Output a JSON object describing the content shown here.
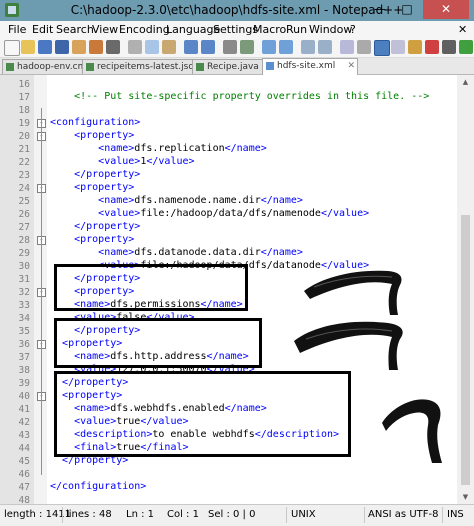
{
  "window": {
    "title": "C:\\hadoop-2.3.0\\etc\\hadoop\\hdfs-site.xml - Notepad++"
  },
  "menu": [
    "File",
    "Edit",
    "Search",
    "View",
    "Encoding",
    "Language",
    "Settings",
    "Macro",
    "Run",
    "Window",
    "?"
  ],
  "tabs": [
    {
      "label": "hadoop-env.cmd"
    },
    {
      "label": "recipeitems-latest.json"
    },
    {
      "label": "Recipe.java"
    },
    {
      "label": "hdfs-site.xml"
    }
  ],
  "lines": [
    {
      "num": "16",
      "parts": []
    },
    {
      "num": "17",
      "parts": [
        {
          "t": "    ",
          "c": "c-text"
        },
        {
          "t": "<!-- Put site-specific property overrides in this file. -->",
          "c": "c-comment"
        }
      ]
    },
    {
      "num": "18",
      "parts": []
    },
    {
      "num": "19",
      "parts": [
        {
          "t": "<configuration>",
          "c": "c-tag"
        }
      ]
    },
    {
      "num": "20",
      "parts": [
        {
          "t": "    ",
          "c": "c-text"
        },
        {
          "t": "<property>",
          "c": "c-tag"
        }
      ]
    },
    {
      "num": "21",
      "parts": [
        {
          "t": "        ",
          "c": "c-text"
        },
        {
          "t": "<name>",
          "c": "c-tag"
        },
        {
          "t": "dfs.replication",
          "c": "c-text"
        },
        {
          "t": "</name>",
          "c": "c-tag"
        }
      ]
    },
    {
      "num": "22",
      "parts": [
        {
          "t": "        ",
          "c": "c-text"
        },
        {
          "t": "<value>",
          "c": "c-tag"
        },
        {
          "t": "1",
          "c": "c-text"
        },
        {
          "t": "</value>",
          "c": "c-tag"
        }
      ]
    },
    {
      "num": "23",
      "parts": [
        {
          "t": "    ",
          "c": "c-text"
        },
        {
          "t": "</property>",
          "c": "c-tag"
        }
      ]
    },
    {
      "num": "24",
      "parts": [
        {
          "t": "    ",
          "c": "c-text"
        },
        {
          "t": "<property>",
          "c": "c-tag"
        }
      ]
    },
    {
      "num": "25",
      "parts": [
        {
          "t": "        ",
          "c": "c-text"
        },
        {
          "t": "<name>",
          "c": "c-tag"
        },
        {
          "t": "dfs.namenode.name.dir",
          "c": "c-text"
        },
        {
          "t": "</name>",
          "c": "c-tag"
        }
      ]
    },
    {
      "num": "26",
      "parts": [
        {
          "t": "        ",
          "c": "c-text"
        },
        {
          "t": "<value>",
          "c": "c-tag"
        },
        {
          "t": "file:/hadoop/data/dfs/namenode",
          "c": "c-text"
        },
        {
          "t": "</value>",
          "c": "c-tag"
        }
      ]
    },
    {
      "num": "27",
      "parts": [
        {
          "t": "    ",
          "c": "c-text"
        },
        {
          "t": "</property>",
          "c": "c-tag"
        }
      ]
    },
    {
      "num": "28",
      "parts": [
        {
          "t": "    ",
          "c": "c-text"
        },
        {
          "t": "<property>",
          "c": "c-tag"
        }
      ]
    },
    {
      "num": "29",
      "parts": [
        {
          "t": "        ",
          "c": "c-text"
        },
        {
          "t": "<name>",
          "c": "c-tag"
        },
        {
          "t": "dfs.datanode.data.dir",
          "c": "c-text"
        },
        {
          "t": "</name>",
          "c": "c-tag"
        }
      ]
    },
    {
      "num": "30",
      "parts": [
        {
          "t": "        ",
          "c": "c-text"
        },
        {
          "t": "<value>",
          "c": "c-tag"
        },
        {
          "t": "file:/hadoop/data/dfs/datanode",
          "c": "c-text"
        },
        {
          "t": "</value>",
          "c": "c-tag"
        }
      ]
    },
    {
      "num": "31",
      "parts": [
        {
          "t": "    ",
          "c": "c-text"
        },
        {
          "t": "</property>",
          "c": "c-tag"
        }
      ]
    },
    {
      "num": "32",
      "parts": [
        {
          "t": "    ",
          "c": "c-text"
        },
        {
          "t": "<property>",
          "c": "c-tag"
        }
      ]
    },
    {
      "num": "33",
      "parts": [
        {
          "t": "    ",
          "c": "c-text"
        },
        {
          "t": "<name>",
          "c": "c-tag"
        },
        {
          "t": "dfs.permissions",
          "c": "c-text"
        },
        {
          "t": "</name>",
          "c": "c-tag"
        }
      ]
    },
    {
      "num": "34",
      "parts": [
        {
          "t": "    ",
          "c": "c-text"
        },
        {
          "t": "<value>",
          "c": "c-tag"
        },
        {
          "t": "false",
          "c": "c-text"
        },
        {
          "t": "</value>",
          "c": "c-tag"
        }
      ]
    },
    {
      "num": "35",
      "parts": [
        {
          "t": "    ",
          "c": "c-text"
        },
        {
          "t": "</property>",
          "c": "c-tag"
        }
      ]
    },
    {
      "num": "36",
      "parts": [
        {
          "t": "  ",
          "c": "c-text"
        },
        {
          "t": "<property>",
          "c": "c-tag"
        }
      ]
    },
    {
      "num": "37",
      "parts": [
        {
          "t": "    ",
          "c": "c-text"
        },
        {
          "t": "<name>",
          "c": "c-tag"
        },
        {
          "t": "dfs.http.address",
          "c": "c-text"
        },
        {
          "t": "</name>",
          "c": "c-tag"
        }
      ]
    },
    {
      "num": "38",
      "parts": [
        {
          "t": "    ",
          "c": "c-text"
        },
        {
          "t": "<value>",
          "c": "c-tag"
        },
        {
          "t": "127.0.0.1:50070",
          "c": "c-text"
        },
        {
          "t": "</value>",
          "c": "c-tag"
        }
      ]
    },
    {
      "num": "39",
      "parts": [
        {
          "t": "  ",
          "c": "c-text"
        },
        {
          "t": "</property>",
          "c": "c-tag"
        }
      ]
    },
    {
      "num": "40",
      "parts": [
        {
          "t": "  ",
          "c": "c-text"
        },
        {
          "t": "<property>",
          "c": "c-tag"
        }
      ]
    },
    {
      "num": "41",
      "parts": [
        {
          "t": "    ",
          "c": "c-text"
        },
        {
          "t": "<name>",
          "c": "c-tag"
        },
        {
          "t": "dfs.webhdfs.enabled",
          "c": "c-text"
        },
        {
          "t": "</name>",
          "c": "c-tag"
        }
      ]
    },
    {
      "num": "42",
      "parts": [
        {
          "t": "    ",
          "c": "c-text"
        },
        {
          "t": "<value>",
          "c": "c-tag"
        },
        {
          "t": "true",
          "c": "c-text"
        },
        {
          "t": "</value>",
          "c": "c-tag"
        }
      ]
    },
    {
      "num": "43",
      "parts": [
        {
          "t": "    ",
          "c": "c-text"
        },
        {
          "t": "<description>",
          "c": "c-tag"
        },
        {
          "t": "to enable webhdfs",
          "c": "c-text"
        },
        {
          "t": "</description>",
          "c": "c-tag"
        }
      ]
    },
    {
      "num": "44",
      "parts": [
        {
          "t": "    ",
          "c": "c-text"
        },
        {
          "t": "<final>",
          "c": "c-tag"
        },
        {
          "t": "true",
          "c": "c-text"
        },
        {
          "t": "</final>",
          "c": "c-tag"
        }
      ]
    },
    {
      "num": "45",
      "parts": [
        {
          "t": "  ",
          "c": "c-text"
        },
        {
          "t": "</property>",
          "c": "c-tag"
        }
      ]
    },
    {
      "num": "46",
      "parts": []
    },
    {
      "num": "47",
      "parts": [
        {
          "t": "</configuration>",
          "c": "c-tag"
        }
      ]
    },
    {
      "num": "48",
      "parts": []
    }
  ],
  "status": {
    "length": "length : 1411",
    "lines": "lines : 48",
    "ln": "Ln : 1",
    "col": "Col : 1",
    "sel": "Sel : 0 | 0",
    "eol": "UNIX",
    "encoding": "ANSI as UTF-8",
    "mode": "INS"
  },
  "colors": {
    "comment": "#008000",
    "tag": "#0000ff",
    "text": "#000000",
    "titlebar": "#6d9bb0"
  }
}
